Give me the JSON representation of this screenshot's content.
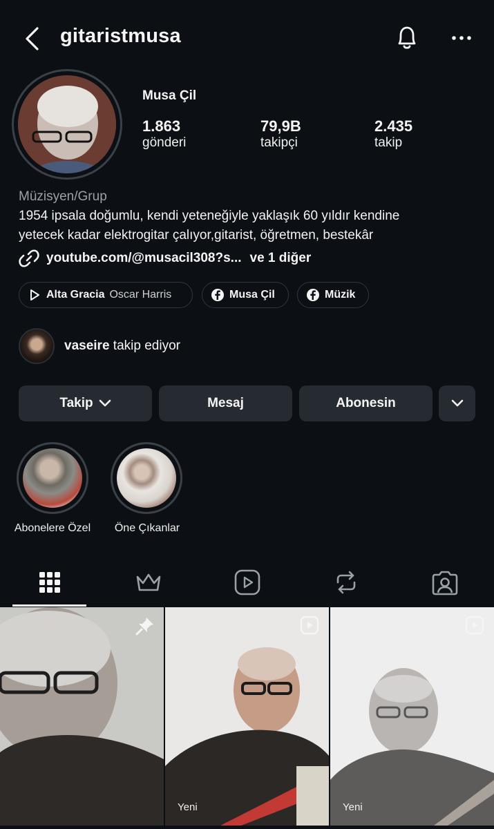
{
  "header": {
    "username": "gitaristmusa",
    "back_icon": "back-arrow-icon",
    "bell_icon": "bell-icon",
    "more_icon": "more-icon"
  },
  "profile": {
    "name": "Musa Çil",
    "stats": [
      {
        "value": "1.863",
        "label": "gönderi"
      },
      {
        "value": "79,9B",
        "label": "takipçi"
      },
      {
        "value": "2.435",
        "label": "takip"
      }
    ],
    "category": "Müzisyen/Grup",
    "bio_line1": "1954 ipsala doğumlu, kendi yeteneğiyle yaklaşık 60 yıldır kendine",
    "bio_line2": "yetecek kadar elektrogitar çalıyor,gitarist, öğretmen, bestekâr",
    "link": "youtube.com/@musacil308?s...",
    "link_more": "ve 1 diğer"
  },
  "chips": [
    {
      "title": "Alta Gracia",
      "subtitle": "Oscar Harris",
      "icon": "play-icon"
    },
    {
      "title": "Musa Çil",
      "icon": "facebook-icon"
    },
    {
      "title": "Müzik",
      "icon": "facebook-icon"
    }
  ],
  "followed_by": {
    "user": "vaseire",
    "text": "takip ediyor"
  },
  "actions": {
    "follow": "Takip",
    "message": "Mesaj",
    "subscribed": "Abonesin"
  },
  "highlights": [
    {
      "label": "Abonelere Özel"
    },
    {
      "label": "Öne Çıkanlar"
    }
  ],
  "tabs": [
    "grid-icon",
    "crown-icon",
    "reels-icon",
    "repost-icon",
    "tagged-icon"
  ],
  "grid": [
    {
      "badge": "pin-icon",
      "label": ""
    },
    {
      "badge": "reel-badge-icon",
      "label": "Yeni"
    },
    {
      "badge": "reel-badge-icon",
      "label": "Yeni"
    }
  ],
  "colors": {
    "background": "#0c1014",
    "button": "#262b31",
    "muted_text": "#9aa2a9"
  }
}
